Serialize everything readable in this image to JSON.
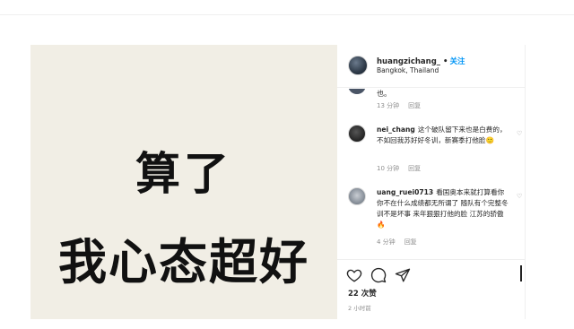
{
  "post": {
    "image_text_line1": "算了",
    "image_text_line2": "我心态超好"
  },
  "header": {
    "username": "huangzichang_",
    "separator": "•",
    "follow_label": "关注",
    "location": "Bangkok, Thailand"
  },
  "partial_comment": {
    "text_fragment": "也。",
    "time": "13 分钟",
    "reply_label": "回复"
  },
  "comments": [
    {
      "username": "nei_chang",
      "text": "这个破队留下来也是白费的，不如回我苏好好冬训，新赛季打他脸🙂",
      "time": "10 分钟",
      "reply_label": "回复"
    },
    {
      "username": "uang_ruei0713",
      "text": "看国奥本来就打算看你 你不在什么成绩都无所谓了 随队有个完整冬训不是坏事 来年狠狠打他的脸 江苏的骄傲🔥",
      "time": "4 分钟",
      "reply_label": "回复"
    }
  ],
  "actions": {
    "like_icon": "heart-icon",
    "comment_icon": "comment-icon",
    "share_icon": "share-icon"
  },
  "stats": {
    "likes": "22 次赞",
    "posted_time": "2 小时前"
  },
  "colors": {
    "follow_blue": "#0095f6",
    "image_bg": "#f1eee5",
    "muted_text": "#8e8e8e"
  }
}
